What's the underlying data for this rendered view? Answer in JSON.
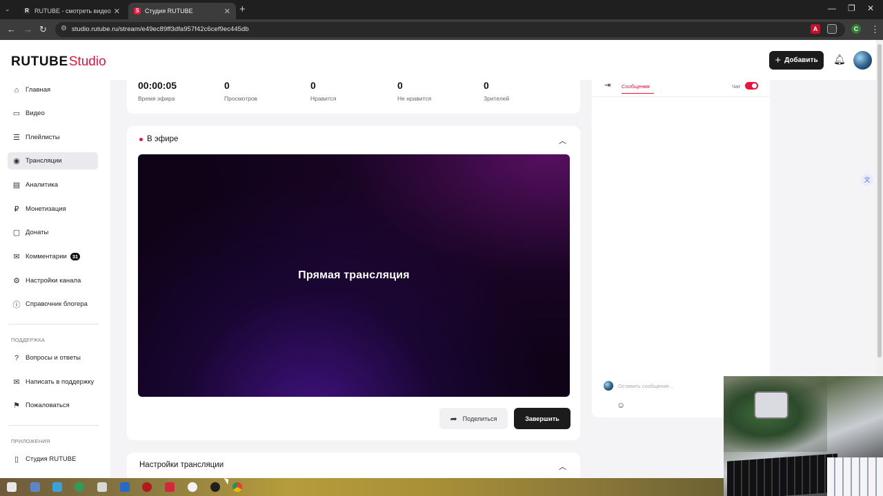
{
  "browser": {
    "tabs": [
      {
        "title": "RUTUBE - смотреть видео онл...",
        "favicon": "R",
        "favicon_color": "#1f1f1f"
      },
      {
        "title": "Студия RUTUBE",
        "favicon": "S",
        "favicon_color": "#ed143b"
      }
    ],
    "url": "studio.rutube.ru/stream/e49ec89ff3dfa957f42c6cef9ec445db"
  },
  "header": {
    "logo_main": "RUTUBE",
    "logo_studio": "Studio",
    "add_label": "Добавить"
  },
  "sidebar": {
    "items": [
      {
        "label": "Главная",
        "icon": "home-icon"
      },
      {
        "label": "Видео",
        "icon": "video-icon"
      },
      {
        "label": "Плейлисты",
        "icon": "playlist-icon"
      },
      {
        "label": "Трансляции",
        "icon": "broadcast-icon",
        "active": true
      },
      {
        "label": "Аналитика",
        "icon": "analytics-icon"
      },
      {
        "label": "Монетизация",
        "icon": "monetization-icon"
      },
      {
        "label": "Донаты",
        "icon": "donate-icon"
      },
      {
        "label": "Комментарии",
        "icon": "comments-icon",
        "badge": "31"
      },
      {
        "label": "Настройки канала",
        "icon": "gear-icon"
      },
      {
        "label": "Справочник блогера",
        "icon": "info-icon"
      }
    ],
    "support_heading": "ПОДДЕРЖКА",
    "support_items": [
      {
        "label": "Вопросы и ответы",
        "icon": "question-icon"
      },
      {
        "label": "Написать в поддержку",
        "icon": "mail-icon"
      },
      {
        "label": "Пожаловаться",
        "icon": "flag-icon"
      }
    ],
    "apps_heading": "ПРИЛОЖЕНИЯ",
    "apps_items": [
      {
        "label": "Студия RUTUBE",
        "icon": "phone-icon"
      }
    ]
  },
  "stats": [
    {
      "value": "00:00:05",
      "label": "Время эфира"
    },
    {
      "value": "0",
      "label": "Просмотров"
    },
    {
      "value": "0",
      "label": "Нравится"
    },
    {
      "value": "0",
      "label": "Не нравится"
    },
    {
      "value": "0",
      "label": "Зрителей"
    }
  ],
  "live": {
    "heading": "В эфире",
    "player_title": "Прямая трансляция",
    "share_label": "Поделиться",
    "end_label": "Завершить"
  },
  "settings": {
    "title": "Настройки трансляции"
  },
  "chat": {
    "tab_messages": "Сообщения",
    "chat_label": "Чат",
    "chat_enabled": true,
    "input_placeholder": "Оставить сообщение..."
  },
  "colors": {
    "accent": "#ed143b",
    "primary_button": "#1c1c1c",
    "active_nav": "#e9e9ee"
  }
}
